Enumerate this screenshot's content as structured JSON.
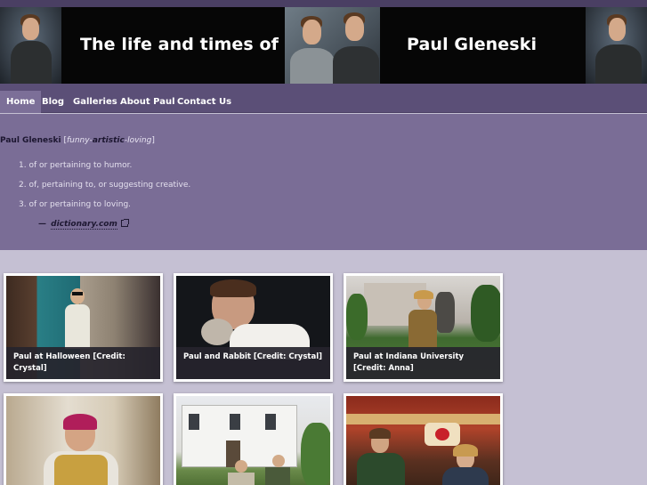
{
  "header": {
    "title_left": "The life and times of",
    "title_right": "Paul Gleneski"
  },
  "nav": {
    "items": [
      "Home",
      "Blog",
      "Galleries",
      "About Paul",
      "Contact Us"
    ],
    "active": "Home"
  },
  "definition": {
    "word": "Paul Gleneski",
    "open_bracket": "[",
    "pron_1": "funny",
    "pron_sep_1": "-",
    "pron_2": "artistic",
    "pron_sep_2": "-",
    "pron_3": "loving",
    "close_bracket": "]",
    "meanings": [
      "1. of or pertaining to humor.",
      "2. of, pertaining to, or suggesting creative.",
      "3. of or pertaining to loving."
    ],
    "source_dash": "—",
    "source": "dictionary.com"
  },
  "gallery": {
    "items": [
      {
        "caption": "Paul at Halloween [Credit: Crystal]"
      },
      {
        "caption": "Paul and Rabbit [Credit: Crystal]"
      },
      {
        "caption": "Paul at Indiana University [Credit: Anna]"
      },
      {
        "caption": ""
      },
      {
        "caption": ""
      },
      {
        "caption": ""
      }
    ]
  },
  "colors": {
    "banner": "#060606",
    "nav": "#5b4f77",
    "nav_active": "#7c6f98",
    "intro": "#7a6d96",
    "page": "#c5c0d3"
  }
}
